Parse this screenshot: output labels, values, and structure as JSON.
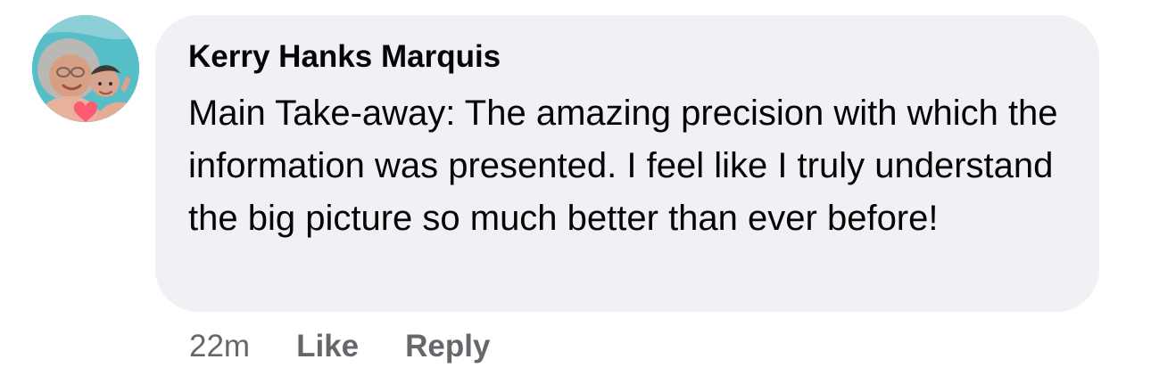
{
  "comment": {
    "author": "Kerry Hanks Marquis",
    "text": "Main Take-away: The amazing precision with which the information was presented. I feel like I truly understand the big picture so much better than ever before!",
    "timestamp": "22m",
    "actions": {
      "like_label": "Like",
      "reply_label": "Reply"
    }
  },
  "colors": {
    "bubble_background": "#f0f0f5",
    "text_primary": "#050505",
    "text_secondary": "#65676b"
  },
  "icons": {
    "avatar": "profile-photo"
  }
}
